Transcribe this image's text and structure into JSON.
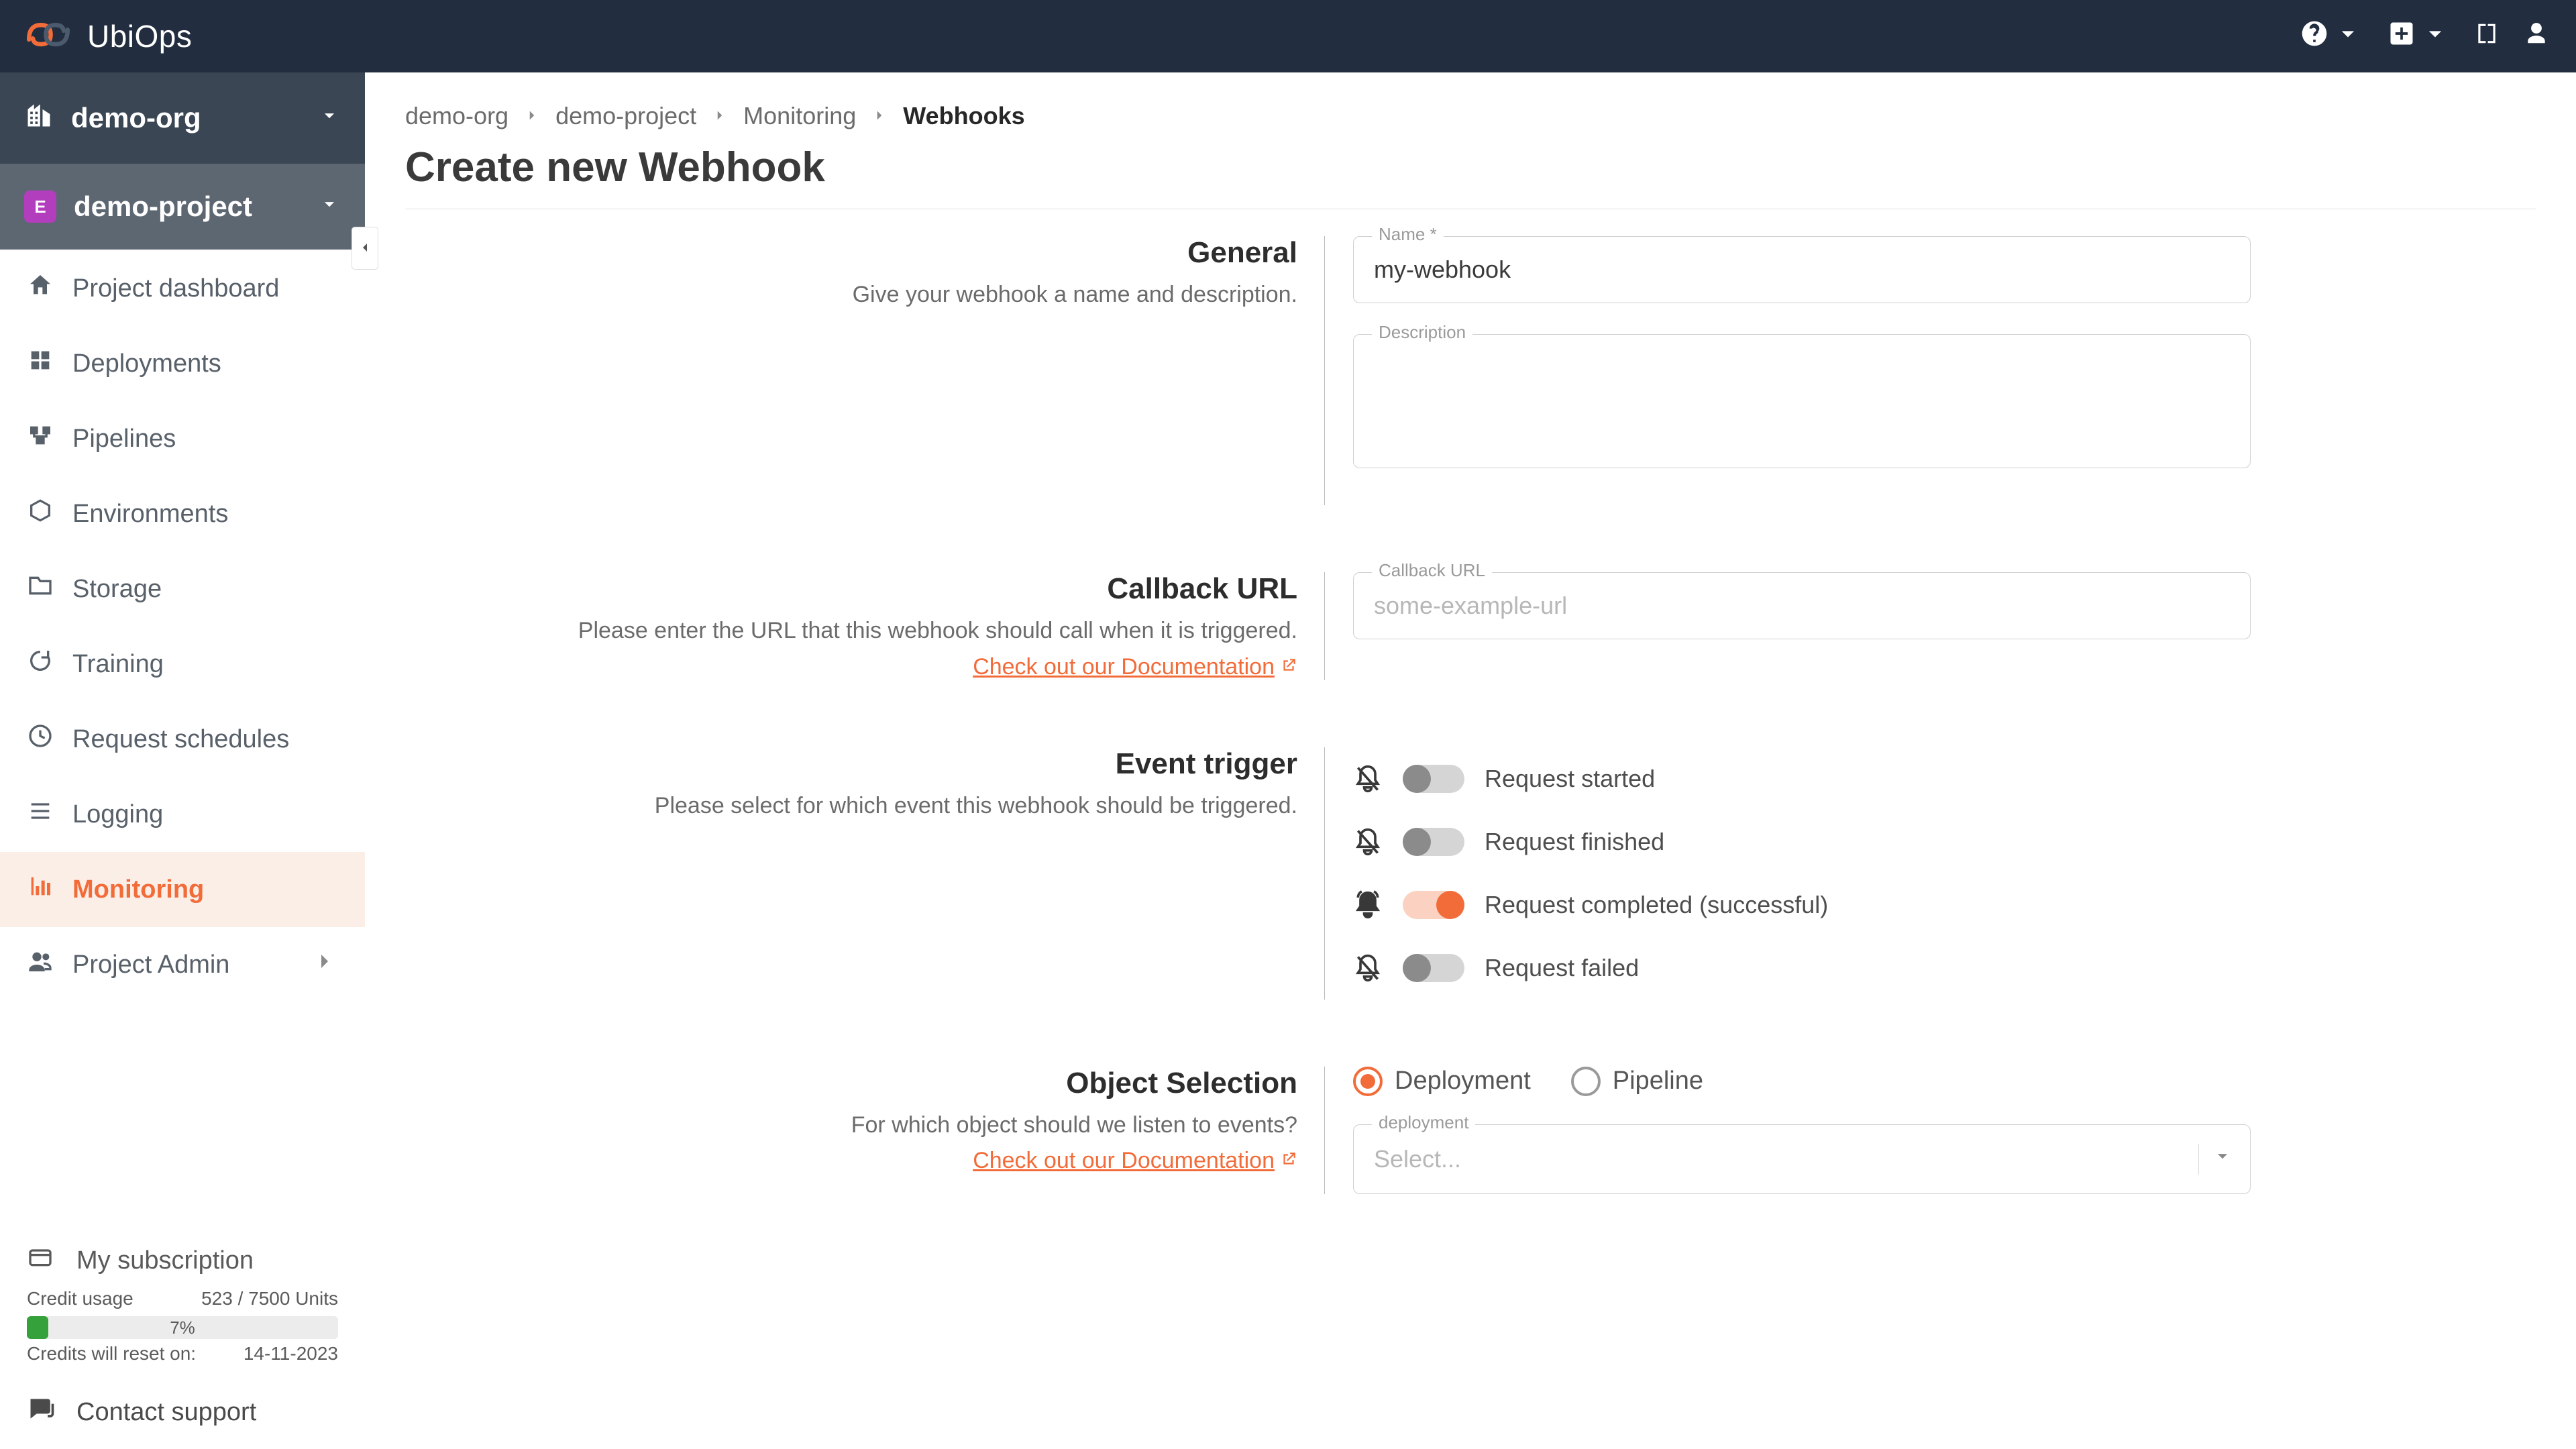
{
  "brand": {
    "name": "UbiOps"
  },
  "sidebar": {
    "org": "demo-org",
    "project": "demo-project",
    "project_initial": "E",
    "items": [
      {
        "label": "Project dashboard"
      },
      {
        "label": "Deployments"
      },
      {
        "label": "Pipelines"
      },
      {
        "label": "Environments"
      },
      {
        "label": "Storage"
      },
      {
        "label": "Training"
      },
      {
        "label": "Request schedules"
      },
      {
        "label": "Logging"
      },
      {
        "label": "Monitoring"
      },
      {
        "label": "Project Admin"
      }
    ],
    "subscription_label": "My subscription",
    "credit_usage_label": "Credit usage",
    "credit_usage_value": "523 / 7500 Units",
    "credit_pct": "7%",
    "credit_reset_label": "Credits will reset on:",
    "credit_reset_value": "14-11-2023",
    "contact_label": "Contact support"
  },
  "breadcrumb": {
    "items": [
      "demo-org",
      "demo-project",
      "Monitoring"
    ],
    "current": "Webhooks"
  },
  "page": {
    "title": "Create new Webhook"
  },
  "sections": {
    "general": {
      "title": "General",
      "desc": "Give your webhook a name and description.",
      "name_label": "Name *",
      "name_value": "my-webhook",
      "description_label": "Description"
    },
    "callback": {
      "title": "Callback URL",
      "desc": "Please enter the URL that this webhook should call when it is triggered.",
      "doc_link": "Check out our Documentation ",
      "field_label": "Callback URL",
      "placeholder": "some-example-url"
    },
    "event": {
      "title": "Event trigger",
      "desc": "Please select for which event this webhook should be triggered.",
      "options": [
        {
          "label": "Request started",
          "on": false
        },
        {
          "label": "Request finished",
          "on": false
        },
        {
          "label": "Request completed (successful)",
          "on": true
        },
        {
          "label": "Request failed",
          "on": false
        }
      ]
    },
    "object": {
      "title": "Object Selection",
      "desc": "For which object should we listen to events?",
      "doc_link": "Check out our Documentation ",
      "radio_deployment": "Deployment",
      "radio_pipeline": "Pipeline",
      "select_label": "deployment",
      "select_placeholder": "Select..."
    }
  }
}
